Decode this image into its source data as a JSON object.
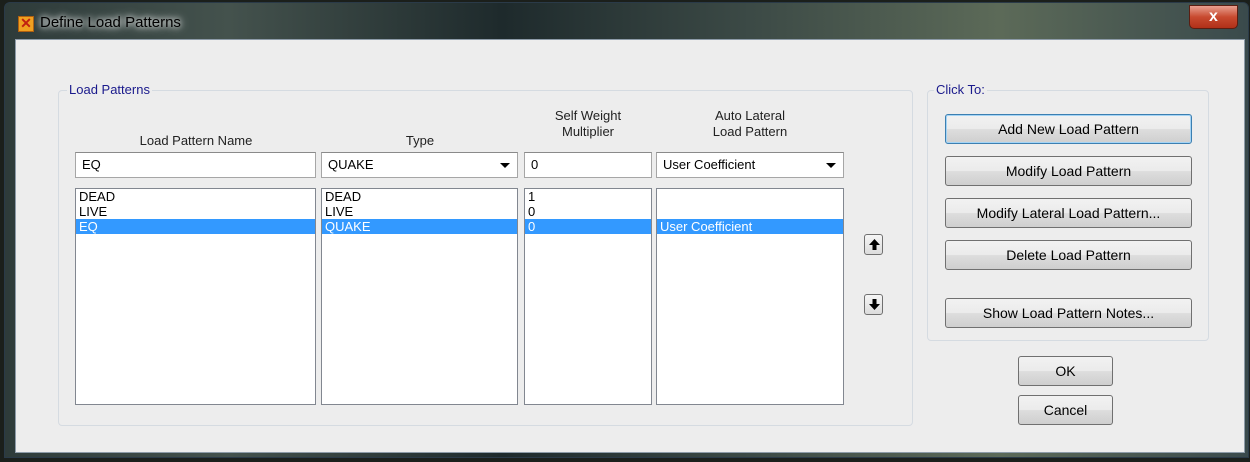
{
  "window": {
    "title": "Define Load Patterns",
    "close_label": "x"
  },
  "load_patterns": {
    "group_title": "Load Patterns",
    "headers": {
      "name": "Load Pattern Name",
      "type": "Type",
      "self_weight": [
        "Self Weight",
        "Multiplier"
      ],
      "auto_lateral": [
        "Auto Lateral",
        "Load Pattern"
      ]
    },
    "inputs": {
      "name": "EQ",
      "type": "QUAKE",
      "self_weight": "0",
      "auto_lateral": "User Coefficient"
    },
    "rows": [
      {
        "name": "DEAD",
        "type": "DEAD",
        "self_weight": "1",
        "auto_lateral": "",
        "selected": false
      },
      {
        "name": "LIVE",
        "type": "LIVE",
        "self_weight": "0",
        "auto_lateral": "",
        "selected": false
      },
      {
        "name": "EQ",
        "type": "QUAKE",
        "self_weight": "0",
        "auto_lateral": "User Coefficient",
        "selected": true
      }
    ]
  },
  "click_to": {
    "group_title": "Click To:",
    "buttons": {
      "add": "Add New Load Pattern",
      "modify": "Modify Load Pattern",
      "modify_lateral": "Modify Lateral Load Pattern...",
      "delete": "Delete Load Pattern",
      "notes": "Show Load Pattern Notes..."
    }
  },
  "dialog": {
    "ok": "OK",
    "cancel": "Cancel"
  },
  "colors": {
    "selection": "#3399ff",
    "group_title": "#1a1a8c"
  }
}
